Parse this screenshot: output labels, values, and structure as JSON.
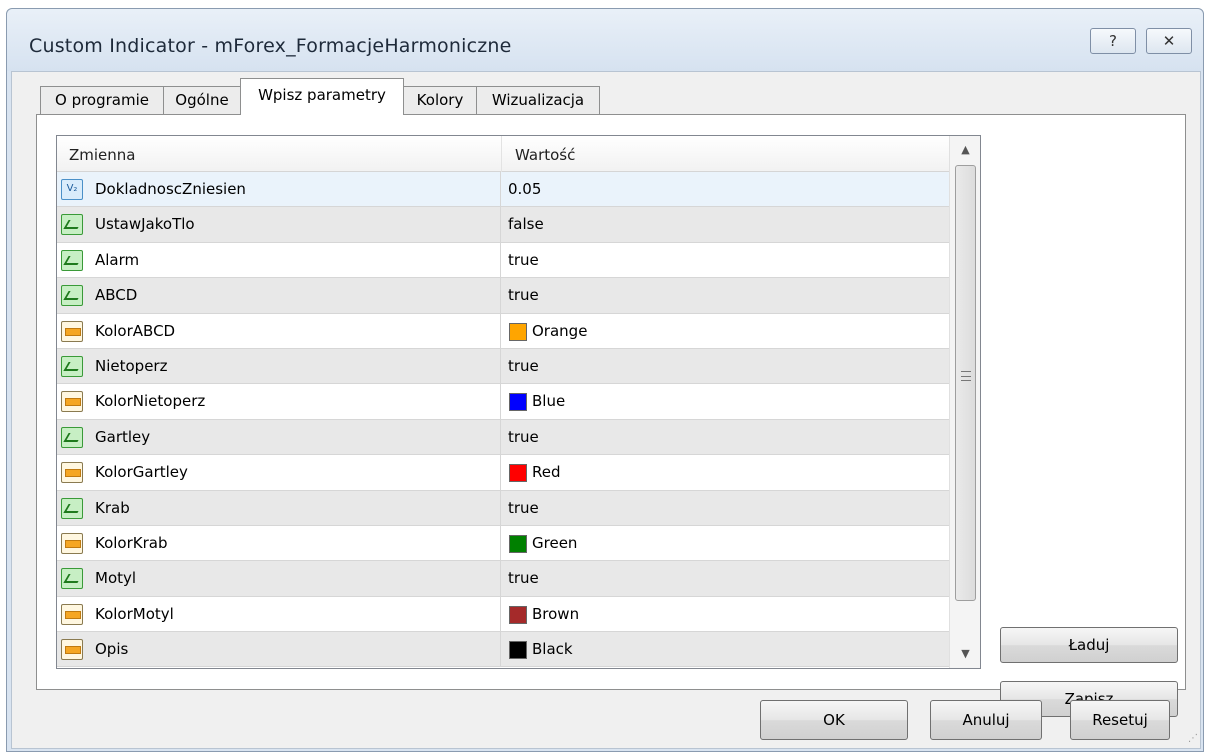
{
  "window": {
    "title": "Custom Indicator - mForex_FormacjeHarmoniczne",
    "help_label": "?",
    "close_label": "✕"
  },
  "tabs": [
    {
      "label": "O programie",
      "active": false
    },
    {
      "label": "Ogólne",
      "active": false
    },
    {
      "label": "Wpisz parametry",
      "active": true
    },
    {
      "label": "Kolory",
      "active": false
    },
    {
      "label": "Wizualizacja",
      "active": false
    }
  ],
  "grid": {
    "columns": [
      "Zmienna",
      "Wartość"
    ],
    "rows": [
      {
        "icon": "double-type-icon",
        "name": "DokladnoscZniesien",
        "value": "0.05"
      },
      {
        "icon": "bool-type-icon",
        "name": "UstawJakoTlo",
        "value": "false"
      },
      {
        "icon": "bool-type-icon",
        "name": "Alarm",
        "value": "true"
      },
      {
        "icon": "bool-type-icon",
        "name": "ABCD",
        "value": "true"
      },
      {
        "icon": "color-type-icon",
        "name": "KolorABCD",
        "value": "Orange",
        "color": "#ffa500"
      },
      {
        "icon": "bool-type-icon",
        "name": "Nietoperz",
        "value": "true"
      },
      {
        "icon": "color-type-icon",
        "name": "KolorNietoperz",
        "value": "Blue",
        "color": "#0000ff"
      },
      {
        "icon": "bool-type-icon",
        "name": "Gartley",
        "value": "true"
      },
      {
        "icon": "color-type-icon",
        "name": "KolorGartley",
        "value": "Red",
        "color": "#ff0000"
      },
      {
        "icon": "bool-type-icon",
        "name": "Krab",
        "value": "true"
      },
      {
        "icon": "color-type-icon",
        "name": "KolorKrab",
        "value": "Green",
        "color": "#008000"
      },
      {
        "icon": "bool-type-icon",
        "name": "Motyl",
        "value": "true"
      },
      {
        "icon": "color-type-icon",
        "name": "KolorMotyl",
        "value": "Brown",
        "color": "#a52a2a"
      },
      {
        "icon": "color-type-icon",
        "name": "Opis",
        "value": "Black",
        "color": "#000000"
      }
    ]
  },
  "side_buttons": {
    "load_label": "Ładuj",
    "save_label": "Zapisz"
  },
  "footer": {
    "ok_label": "OK",
    "cancel_label": "Anuluj",
    "reset_label": "Resetuj"
  }
}
